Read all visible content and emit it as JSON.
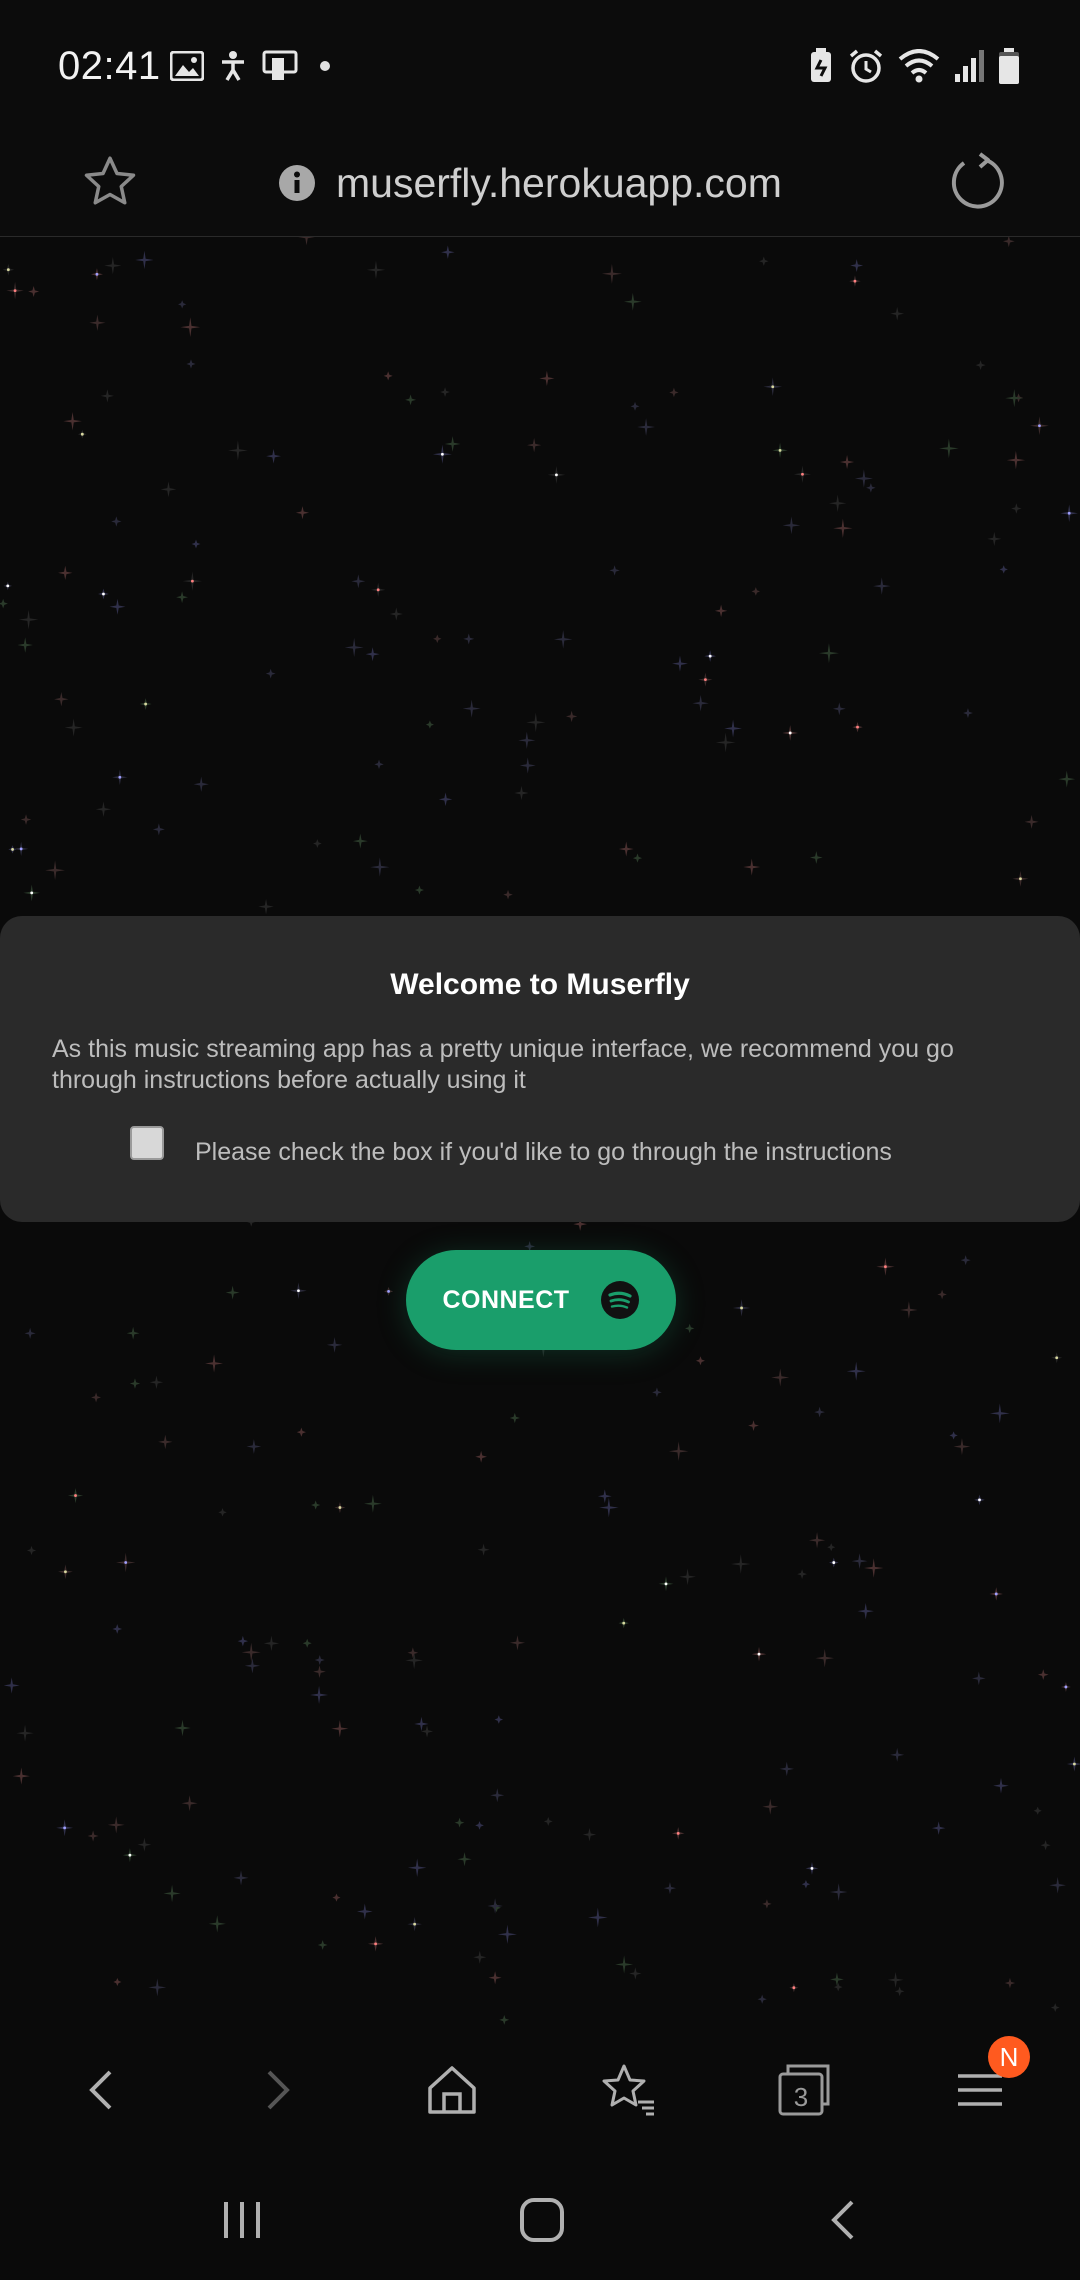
{
  "status_bar": {
    "time": "02:41",
    "left_icons": [
      "gallery-icon",
      "accessibility-icon",
      "screen-cast-icon"
    ],
    "right_icons": [
      "battery-saver-icon",
      "alarm-icon",
      "wifi-icon",
      "signal-icon",
      "battery-icon"
    ]
  },
  "address_bar": {
    "url": "muserfly.herokuapp.com",
    "icons": [
      "star-icon",
      "info-icon",
      "reload-icon"
    ]
  },
  "modal": {
    "title": "Welcome to Muserfly",
    "body": "As this music streaming app has a pretty unique interface, we recommend you go through instructions before actually using it",
    "checkbox_label": "Please check the box if you'd like to go through the instructions"
  },
  "connect_button": {
    "label": "CONNECT",
    "icon": "spotify-icon",
    "color": "#1a9e6b"
  },
  "browser_toolbar": {
    "tab_count": "3",
    "menu_badge": "N",
    "badge_color": "#ff5a1f",
    "icons": [
      "back-icon",
      "forward-icon",
      "home-icon",
      "bookmarks-icon",
      "tabs-icon",
      "menu-icon"
    ]
  },
  "system_nav": {
    "icons": [
      "recent-apps-icon",
      "home-icon",
      "back-icon"
    ]
  }
}
